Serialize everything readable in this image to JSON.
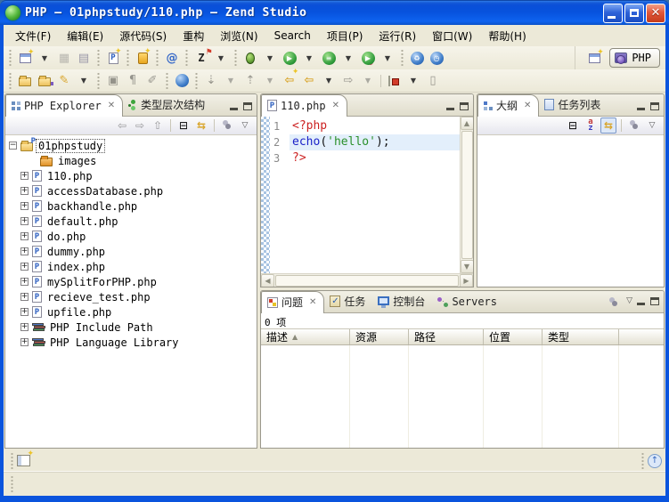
{
  "window": {
    "title": "PHP — 01phpstudy/110.php — Zend Studio",
    "controls": {
      "minimize": "minimize",
      "maximize": "maximize",
      "close": "✕"
    }
  },
  "menu": {
    "items": [
      "文件(F)",
      "编辑(E)",
      "源代码(S)",
      "重构",
      "浏览(N)",
      "Search",
      "项目(P)",
      "运行(R)",
      "窗口(W)",
      "帮助(H)"
    ]
  },
  "toolbar": {
    "zend_label": "Z",
    "php_search_glyph": "@",
    "perspective_label": "PHP"
  },
  "explorer": {
    "tabs": [
      {
        "label": "PHP Explorer"
      },
      {
        "label": "类型层次结构"
      }
    ],
    "project": "01phpstudy",
    "items": [
      {
        "label": "images",
        "type": "folder"
      },
      {
        "label": "110.php",
        "type": "php"
      },
      {
        "label": "accessDatabase.php",
        "type": "php"
      },
      {
        "label": "backhandle.php",
        "type": "php"
      },
      {
        "label": "default.php",
        "type": "php"
      },
      {
        "label": "do.php",
        "type": "php"
      },
      {
        "label": "dummy.php",
        "type": "php"
      },
      {
        "label": "index.php",
        "type": "php"
      },
      {
        "label": "mySplitForPHP.php",
        "type": "php"
      },
      {
        "label": "recieve_test.php",
        "type": "php"
      },
      {
        "label": "upfile.php",
        "type": "php"
      },
      {
        "label": "PHP Include Path",
        "type": "library"
      },
      {
        "label": "PHP Language Library",
        "type": "library"
      }
    ]
  },
  "editor": {
    "tab": "110.php",
    "line_numbers": [
      "1",
      "2",
      "3"
    ],
    "code": {
      "l1": "<?php",
      "l2_kw": "echo",
      "l2_p1": "(",
      "l2_str": "'hello'",
      "l2_p2": ");",
      "l3": "?>"
    }
  },
  "outline": {
    "tabs": [
      {
        "label": "大纲"
      },
      {
        "label": "任务列表"
      }
    ]
  },
  "bottom": {
    "tabs": [
      {
        "label": "问题"
      },
      {
        "label": "任务"
      },
      {
        "label": "控制台"
      },
      {
        "label": "Servers"
      }
    ],
    "count": "0 项",
    "columns": [
      "描述",
      "资源",
      "路径",
      "位置",
      "类型"
    ]
  },
  "colors": {
    "titlebar_blue": "#0a54dd",
    "workbench_bg": "#ece9d8",
    "current_line": "#e3effb",
    "php_tag": "#cc2222",
    "keyword": "#1b22c8",
    "string": "#2a8f2a",
    "link_accent": "#d9a62e"
  }
}
